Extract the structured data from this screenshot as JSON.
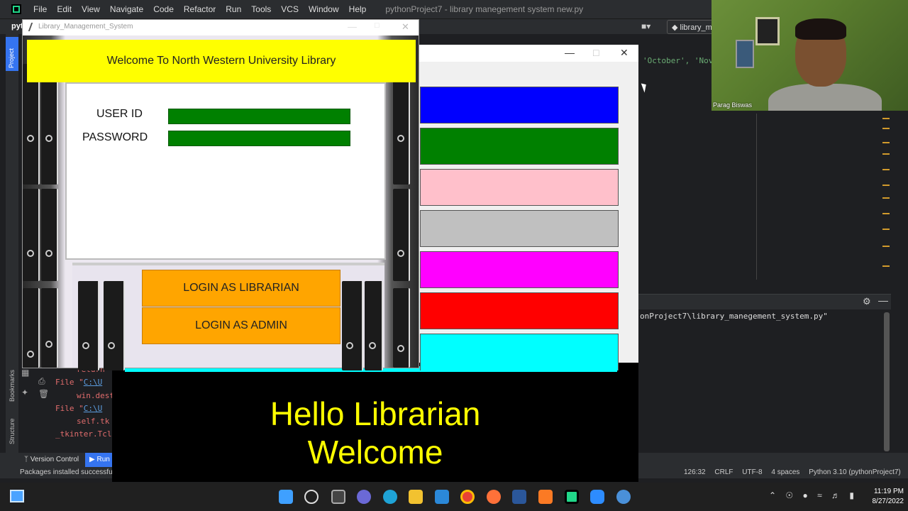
{
  "ide": {
    "menu": [
      "File",
      "Edit",
      "View",
      "Navigate",
      "Code",
      "Refactor",
      "Run",
      "Tools",
      "VCS",
      "Window",
      "Help"
    ],
    "title": "pythonProject7 - library manegement system new.py",
    "toolbar_left": "pyt",
    "run_config": "library_m",
    "project_tab": "Project",
    "bookmarks_tab": "Bookmarks",
    "structure_tab": "Structure",
    "code_snippet_1": "'October', 'Nov",
    "run_output": "onProject7\\library_manegement_system.py\"",
    "trace": [
      {
        "text": "return",
        "indent": true
      },
      {
        "prefix": "File \"",
        "link": "C:\\U",
        "indent": false
      },
      {
        "text": "win.dest",
        "indent": true
      },
      {
        "prefix": "File \"",
        "link": "C:\\U",
        "indent": false
      },
      {
        "text": "self.tk",
        "indent": true
      },
      {
        "text": "_tkinter.Tcl",
        "indent": false
      }
    ],
    "bottom_tabs": {
      "version_control": "Version Control",
      "run": "Run"
    },
    "status_message": "Packages installed successfull",
    "status_right": [
      "126:32",
      "CRLF",
      "UTF-8",
      "4 spaces",
      "Python 3.10 (pythonProject7)"
    ]
  },
  "color_window": {
    "colors": [
      "#0000ff",
      "#008000",
      "#ffc0cb",
      "#c0c0c0",
      "#ff00ff",
      "#ff0000",
      "#00ffff"
    ]
  },
  "hello": {
    "line1": "Hello Librarian",
    "line2": "Welcome"
  },
  "login_window": {
    "title": "Library_Management_System",
    "banner": "Welcome To North Western University Library",
    "userid_label": "USER ID",
    "password_label": "PASSWORD",
    "librarian_button": "LOGIN AS LIBRARIAN",
    "admin_button": "LOGIN AS ADMIN"
  },
  "webcam": {
    "participant_name": "Parag Biswas"
  },
  "taskbar": {
    "time": "11:19 PM",
    "date": "8/27/2022"
  }
}
